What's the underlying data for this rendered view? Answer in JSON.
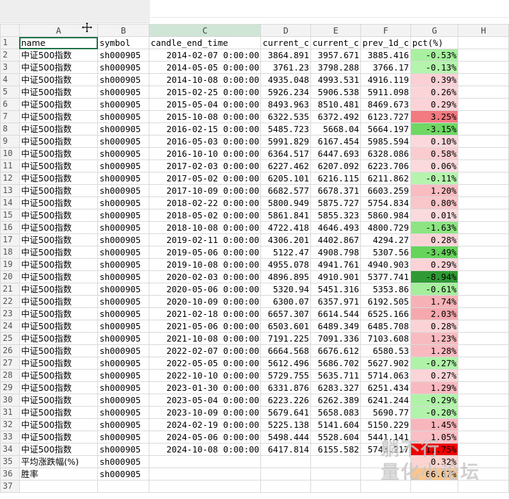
{
  "columns": [
    "A",
    "B",
    "C",
    "D",
    "E",
    "F",
    "G",
    "H"
  ],
  "selected_column": "C",
  "headers": [
    "name",
    "symbol",
    "candle_end_time",
    "current_c",
    "current_c",
    "prev_1d_c",
    "pct(%)",
    ""
  ],
  "rows": [
    {
      "n": "2",
      "name": "中证500指数",
      "symbol": "sh000905",
      "time": "2014-02-07 0:00:00",
      "d": "3864.891",
      "e": "3957.671",
      "f": "3885.416",
      "pct": "-0.53%",
      "bg": "#a8f0a0"
    },
    {
      "n": "3",
      "name": "中证500指数",
      "symbol": "sh000905",
      "time": "2014-05-05 0:00:00",
      "d": "3761.23",
      "e": "3798.288",
      "f": "3766.17",
      "pct": "-0.13%",
      "bg": "#b4f4ac"
    },
    {
      "n": "4",
      "name": "中证500指数",
      "symbol": "sh000905",
      "time": "2014-10-08 0:00:00",
      "d": "4935.048",
      "e": "4993.531",
      "f": "4916.119",
      "pct": "0.39%",
      "bg": "#fbd0d4"
    },
    {
      "n": "5",
      "name": "中证500指数",
      "symbol": "sh000905",
      "time": "2015-02-25 0:00:00",
      "d": "5926.234",
      "e": "5906.538",
      "f": "5911.098",
      "pct": "0.26%",
      "bg": "#fbd4d8"
    },
    {
      "n": "6",
      "name": "中证500指数",
      "symbol": "sh000905",
      "time": "2015-05-04 0:00:00",
      "d": "8493.963",
      "e": "8510.481",
      "f": "8469.673",
      "pct": "0.29%",
      "bg": "#fbd3d7"
    },
    {
      "n": "7",
      "name": "中证500指数",
      "symbol": "sh000905",
      "time": "2015-10-08 0:00:00",
      "d": "6322.535",
      "e": "6372.492",
      "f": "6123.727",
      "pct": "3.25%",
      "bg": "#f27a80"
    },
    {
      "n": "8",
      "name": "中证500指数",
      "symbol": "sh000905",
      "time": "2016-02-15 0:00:00",
      "d": "5485.723",
      "e": "5668.04",
      "f": "5664.197",
      "pct": "-3.15%",
      "bg": "#6fd764"
    },
    {
      "n": "9",
      "name": "中证500指数",
      "symbol": "sh000905",
      "time": "2016-05-03 0:00:00",
      "d": "5991.829",
      "e": "6167.454",
      "f": "5985.594",
      "pct": "0.10%",
      "bg": "#fbd8dc"
    },
    {
      "n": "10",
      "name": "中证500指数",
      "symbol": "sh000905",
      "time": "2016-10-10 0:00:00",
      "d": "6364.517",
      "e": "6447.693",
      "f": "6328.086",
      "pct": "0.58%",
      "bg": "#faccd0"
    },
    {
      "n": "11",
      "name": "中证500指数",
      "symbol": "sh000905",
      "time": "2017-02-03 0:00:00",
      "d": "6227.462",
      "e": "6207.092",
      "f": "6223.706",
      "pct": "0.06%",
      "bg": "#fbd9dd"
    },
    {
      "n": "12",
      "name": "中证500指数",
      "symbol": "sh000905",
      "time": "2017-05-02 0:00:00",
      "d": "6205.101",
      "e": "6216.115",
      "f": "6211.862",
      "pct": "-0.11%",
      "bg": "#b6f4ae"
    },
    {
      "n": "13",
      "name": "中证500指数",
      "symbol": "sh000905",
      "time": "2017-10-09 0:00:00",
      "d": "6682.577",
      "e": "6678.371",
      "f": "6603.259",
      "pct": "1.20%",
      "bg": "#f8bcc1"
    },
    {
      "n": "14",
      "name": "中证500指数",
      "symbol": "sh000905",
      "time": "2018-02-22 0:00:00",
      "d": "5800.949",
      "e": "5875.727",
      "f": "5754.834",
      "pct": "0.80%",
      "bg": "#f9c6ca"
    },
    {
      "n": "15",
      "name": "中证500指数",
      "symbol": "sh000905",
      "time": "2018-05-02 0:00:00",
      "d": "5861.841",
      "e": "5855.323",
      "f": "5860.984",
      "pct": "0.01%",
      "bg": "#fbdadd"
    },
    {
      "n": "16",
      "name": "中证500指数",
      "symbol": "sh000905",
      "time": "2018-10-08 0:00:00",
      "d": "4722.418",
      "e": "4646.493",
      "f": "4800.729",
      "pct": "-1.63%",
      "bg": "#8de482"
    },
    {
      "n": "17",
      "name": "中证500指数",
      "symbol": "sh000905",
      "time": "2019-02-11 0:00:00",
      "d": "4306.201",
      "e": "4402.867",
      "f": "4294.27",
      "pct": "0.28%",
      "bg": "#fbd3d7"
    },
    {
      "n": "18",
      "name": "中证500指数",
      "symbol": "sh000905",
      "time": "2019-05-06 0:00:00",
      "d": "5122.47",
      "e": "4908.798",
      "f": "5307.56",
      "pct": "-3.49%",
      "bg": "#66d35b"
    },
    {
      "n": "19",
      "name": "中证500指数",
      "symbol": "sh000905",
      "time": "2019-10-08 0:00:00",
      "d": "4955.078",
      "e": "4941.761",
      "f": "4940.903",
      "pct": "0.29%",
      "bg": "#fbd3d7"
    },
    {
      "n": "20",
      "name": "中证500指数",
      "symbol": "sh000905",
      "time": "2020-02-03 0:00:00",
      "d": "4896.895",
      "e": "4910.901",
      "f": "5377.741",
      "pct": "-8.94%",
      "bg": "#2f9a34"
    },
    {
      "n": "21",
      "name": "中证500指数",
      "symbol": "sh000905",
      "time": "2020-05-06 0:00:00",
      "d": "5320.94",
      "e": "5451.316",
      "f": "5353.86",
      "pct": "-0.61%",
      "bg": "#a4ee9c"
    },
    {
      "n": "22",
      "name": "中证500指数",
      "symbol": "sh000905",
      "time": "2020-10-09 0:00:00",
      "d": "6300.07",
      "e": "6357.971",
      "f": "6192.505",
      "pct": "1.74%",
      "bg": "#f6b1b6"
    },
    {
      "n": "23",
      "name": "中证500指数",
      "symbol": "sh000905",
      "time": "2021-02-18 0:00:00",
      "d": "6657.307",
      "e": "6614.544",
      "f": "6525.166",
      "pct": "2.03%",
      "bg": "#f5a9ae"
    },
    {
      "n": "24",
      "name": "中证500指数",
      "symbol": "sh000905",
      "time": "2021-05-06 0:00:00",
      "d": "6503.601",
      "e": "6489.349",
      "f": "6485.708",
      "pct": "0.28%",
      "bg": "#fbd3d7"
    },
    {
      "n": "25",
      "name": "中证500指数",
      "symbol": "sh000905",
      "time": "2021-10-08 0:00:00",
      "d": "7191.225",
      "e": "7091.336",
      "f": "7103.608",
      "pct": "1.23%",
      "bg": "#f8bbc0"
    },
    {
      "n": "26",
      "name": "中证500指数",
      "symbol": "sh000905",
      "time": "2022-02-07 0:00:00",
      "d": "6664.568",
      "e": "6676.612",
      "f": "6580.53",
      "pct": "1.28%",
      "bg": "#f8bac0"
    },
    {
      "n": "27",
      "name": "中证500指数",
      "symbol": "sh000905",
      "time": "2022-05-05 0:00:00",
      "d": "5612.496",
      "e": "5686.702",
      "f": "5627.902",
      "pct": "-0.27%",
      "bg": "#b0f2a8"
    },
    {
      "n": "28",
      "name": "中证500指数",
      "symbol": "sh000905",
      "time": "2022-10-10 0:00:00",
      "d": "5729.755",
      "e": "5635.711",
      "f": "5714.063",
      "pct": "0.27%",
      "bg": "#fbd4d8"
    },
    {
      "n": "29",
      "name": "中证500指数",
      "symbol": "sh000905",
      "time": "2023-01-30 0:00:00",
      "d": "6331.876",
      "e": "6283.327",
      "f": "6251.434",
      "pct": "1.29%",
      "bg": "#f8bac0"
    },
    {
      "n": "30",
      "name": "中证500指数",
      "symbol": "sh000905",
      "time": "2023-05-04 0:00:00",
      "d": "6223.226",
      "e": "6262.389",
      "f": "6241.244",
      "pct": "-0.29%",
      "bg": "#b0f2a8"
    },
    {
      "n": "31",
      "name": "中证500指数",
      "symbol": "sh000905",
      "time": "2023-10-09 0:00:00",
      "d": "5679.641",
      "e": "5658.083",
      "f": "5690.77",
      "pct": "-0.20%",
      "bg": "#b2f3aa"
    },
    {
      "n": "32",
      "name": "中证500指数",
      "symbol": "sh000905",
      "time": "2024-02-19 0:00:00",
      "d": "5225.138",
      "e": "5141.604",
      "f": "5150.229",
      "pct": "1.45%",
      "bg": "#f7b6bb"
    },
    {
      "n": "33",
      "name": "中证500指数",
      "symbol": "sh000905",
      "time": "2024-05-06 0:00:00",
      "d": "5498.444",
      "e": "5528.604",
      "f": "5441.141",
      "pct": "1.05%",
      "bg": "#f9bfc4"
    },
    {
      "n": "34",
      "name": "中证500指数",
      "symbol": "sh000905",
      "time": "2024-10-08 0:00:00",
      "d": "6417.814",
      "e": "6155.582",
      "f": "5743.217",
      "pct": "11.75%",
      "bg": "#f00000"
    }
  ],
  "summary": [
    {
      "n": "35",
      "name": "平均涨跌幅(%)",
      "symbol": "sh000905",
      "pct": "0.32%",
      "bg": "#fbd4d0"
    },
    {
      "n": "36",
      "name": "胜率",
      "symbol": "sh000905",
      "pct": "66.67%",
      "bg": "#fbc58f"
    }
  ],
  "empty_rows": [
    "37"
  ],
  "watermark": {
    "line1": "躺不行",
    "line2": "量化小论坛"
  }
}
